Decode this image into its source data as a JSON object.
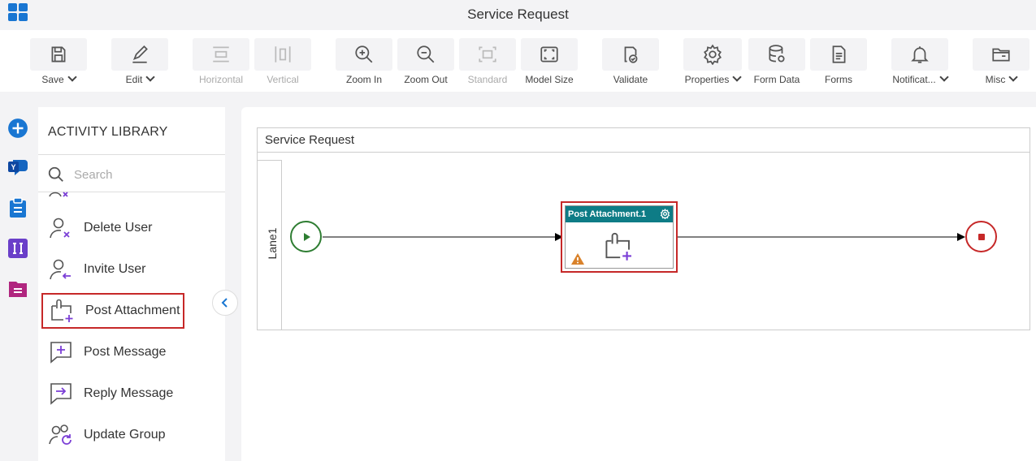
{
  "app": {
    "title": "Service Request"
  },
  "toolbar": {
    "items": [
      {
        "label": "Save",
        "icon": "save-icon",
        "dropdown": true,
        "disabled": false
      },
      {
        "label": "Edit",
        "icon": "edit-icon",
        "dropdown": true,
        "disabled": false
      },
      {
        "label": "Horizontal",
        "icon": "horizontal-icon",
        "dropdown": false,
        "disabled": true
      },
      {
        "label": "Vertical",
        "icon": "vertical-icon",
        "dropdown": false,
        "disabled": true
      },
      {
        "label": "Zoom In",
        "icon": "zoom-in-icon",
        "dropdown": false,
        "disabled": false
      },
      {
        "label": "Zoom Out",
        "icon": "zoom-out-icon",
        "dropdown": false,
        "disabled": false
      },
      {
        "label": "Standard",
        "icon": "standard-icon",
        "dropdown": false,
        "disabled": true
      },
      {
        "label": "Model Size",
        "icon": "model-size-icon",
        "dropdown": false,
        "disabled": false
      },
      {
        "label": "Validate",
        "icon": "validate-icon",
        "dropdown": false,
        "disabled": false
      },
      {
        "label": "Properties",
        "icon": "gear-icon",
        "dropdown": true,
        "disabled": false
      },
      {
        "label": "Form Data",
        "icon": "database-icon",
        "dropdown": false,
        "disabled": false
      },
      {
        "label": "Forms",
        "icon": "forms-icon",
        "dropdown": false,
        "disabled": false
      },
      {
        "label": "Notificat...",
        "icon": "bell-icon",
        "dropdown": true,
        "disabled": false
      },
      {
        "label": "Misc",
        "icon": "folder-icon",
        "dropdown": true,
        "disabled": false
      }
    ]
  },
  "rail": {
    "icons": [
      "add-icon",
      "yammer-icon",
      "clipboard-icon",
      "ii-icon",
      "document-icon"
    ]
  },
  "library": {
    "title": "ACTIVITY LIBRARY",
    "search_placeholder": "Search",
    "items": [
      {
        "label": "Delete User",
        "icon": "delete-user-icon"
      },
      {
        "label": "Invite User",
        "icon": "invite-user-icon"
      },
      {
        "label": "Post Attachment",
        "icon": "post-attachment-icon",
        "highlighted": true
      },
      {
        "label": "Post Message",
        "icon": "post-message-icon"
      },
      {
        "label": "Reply Message",
        "icon": "reply-message-icon"
      },
      {
        "label": "Update Group",
        "icon": "update-group-icon"
      }
    ]
  },
  "canvas": {
    "pool_title": "Service Request",
    "lane_label": "Lane1",
    "task": {
      "title": "Post Attachment.1",
      "warning": true
    }
  },
  "colors": {
    "accent": "#1976d2",
    "task_header": "#0e7c86",
    "highlight": "#c62828",
    "start": "#2e7d32",
    "end": "#c62828",
    "icon_purple": "#7b3fd6"
  }
}
